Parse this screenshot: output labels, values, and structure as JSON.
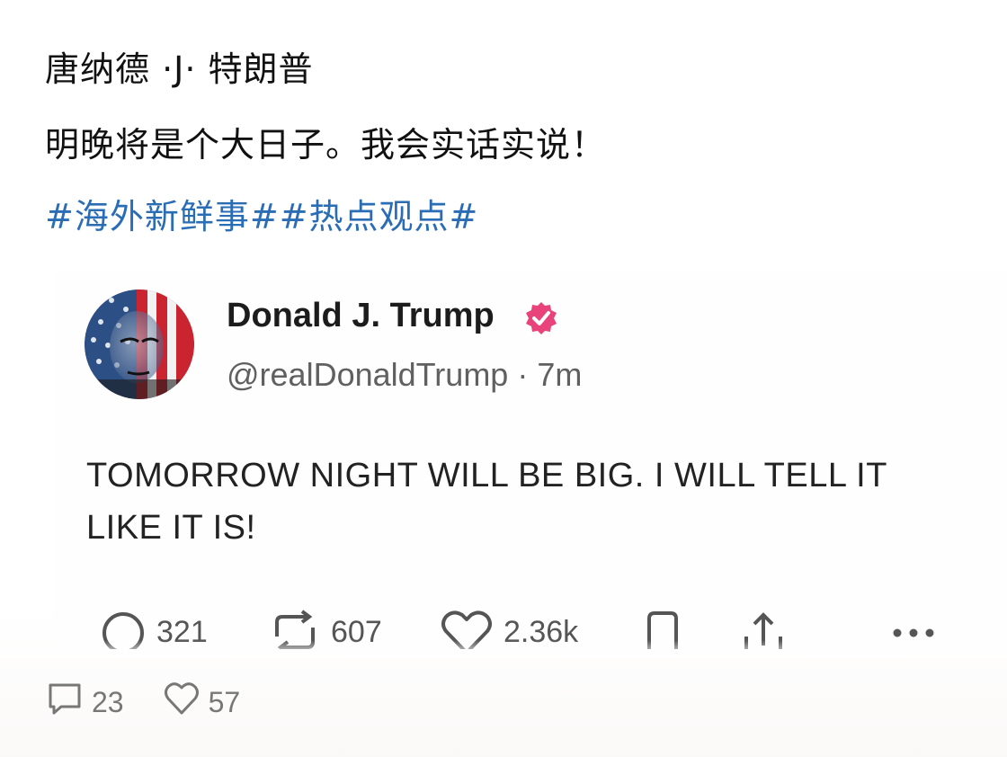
{
  "post": {
    "author": "唐纳德 ·J· 特朗普",
    "text": "明晚将是个大日子。我会实话实说！",
    "tags": [
      "#海外新鲜事#",
      "#热点观点#"
    ]
  },
  "tweet": {
    "display_name": "Donald J. Trump",
    "verified": true,
    "handle": "@realDonaldTrump",
    "separator": " · ",
    "time_ago": "7m",
    "text_line1": "TOMORROW NIGHT WILL BE BIG. I WILL TELL IT",
    "text_line2": "LIKE IT IS!",
    "replies": "321",
    "reposts": "607",
    "likes": "2.36k",
    "icons": [
      "reply-icon",
      "repost-icon",
      "like-icon",
      "bookmark-icon",
      "share-icon",
      "more-icon"
    ]
  },
  "footer": {
    "comments": "23",
    "likes": "57"
  },
  "colors": {
    "tag_blue": "#2a6db5",
    "verified_pink": "#e8437a"
  }
}
